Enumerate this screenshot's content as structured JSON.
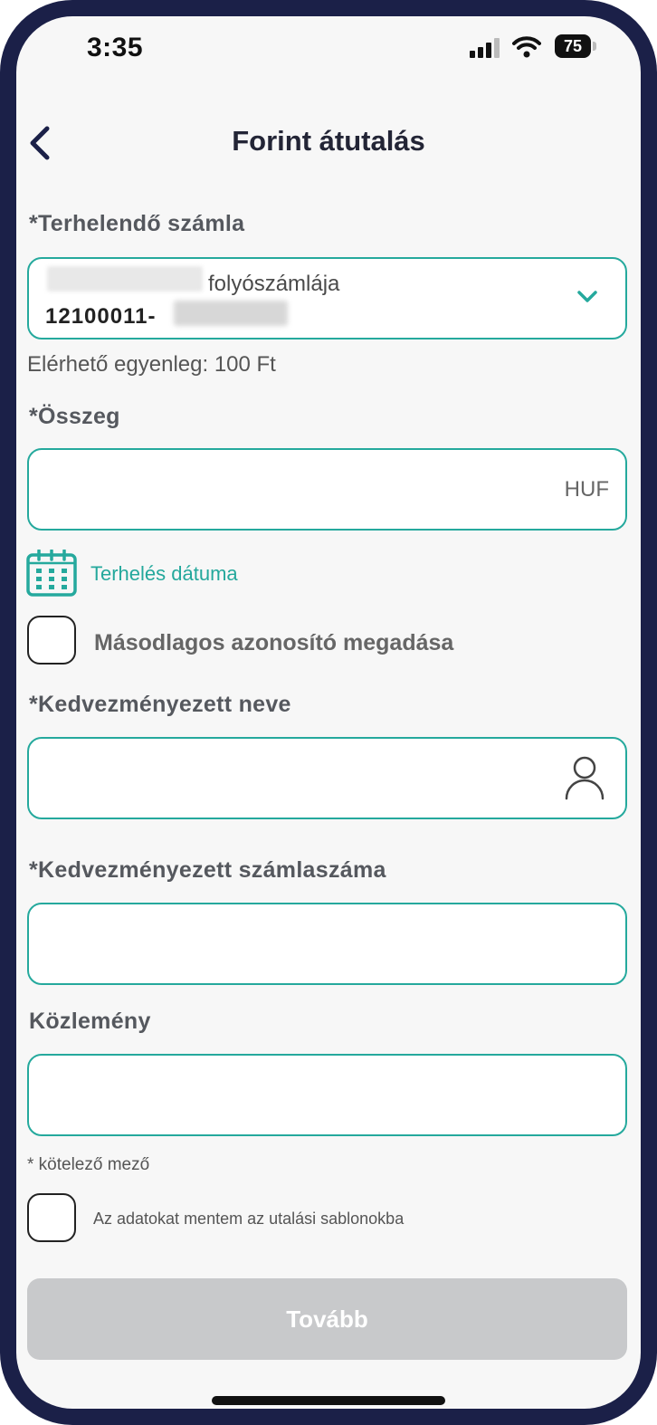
{
  "status_bar": {
    "time": "3:35",
    "battery": "75"
  },
  "header": {
    "title": "Forint átutalás"
  },
  "debit_account": {
    "label": "*Terhelendő számla",
    "name": "folyószámlája",
    "number": "12100011-",
    "balance": "Elérhető egyenleg: 100 Ft"
  },
  "amount": {
    "label": "*Összeg",
    "currency": "HUF"
  },
  "debit_date": {
    "link": "Terhelés dátuma"
  },
  "secondary_id": {
    "label": "Másodlagos azonosító megadása"
  },
  "beneficiary_name": {
    "label": "*Kedvezményezett neve"
  },
  "beneficiary_account": {
    "label": "*Kedvezményezett számlaszáma"
  },
  "notice": {
    "label": "Közlemény"
  },
  "required_note": "* kötelező mező",
  "save_template": {
    "label": "Az adatokat mentem az utalási sablonokba"
  },
  "next_button": "Tovább",
  "colors": {
    "accent": "#25a99d",
    "frame": "#1b2048",
    "disabled": "#c8c9cb"
  }
}
